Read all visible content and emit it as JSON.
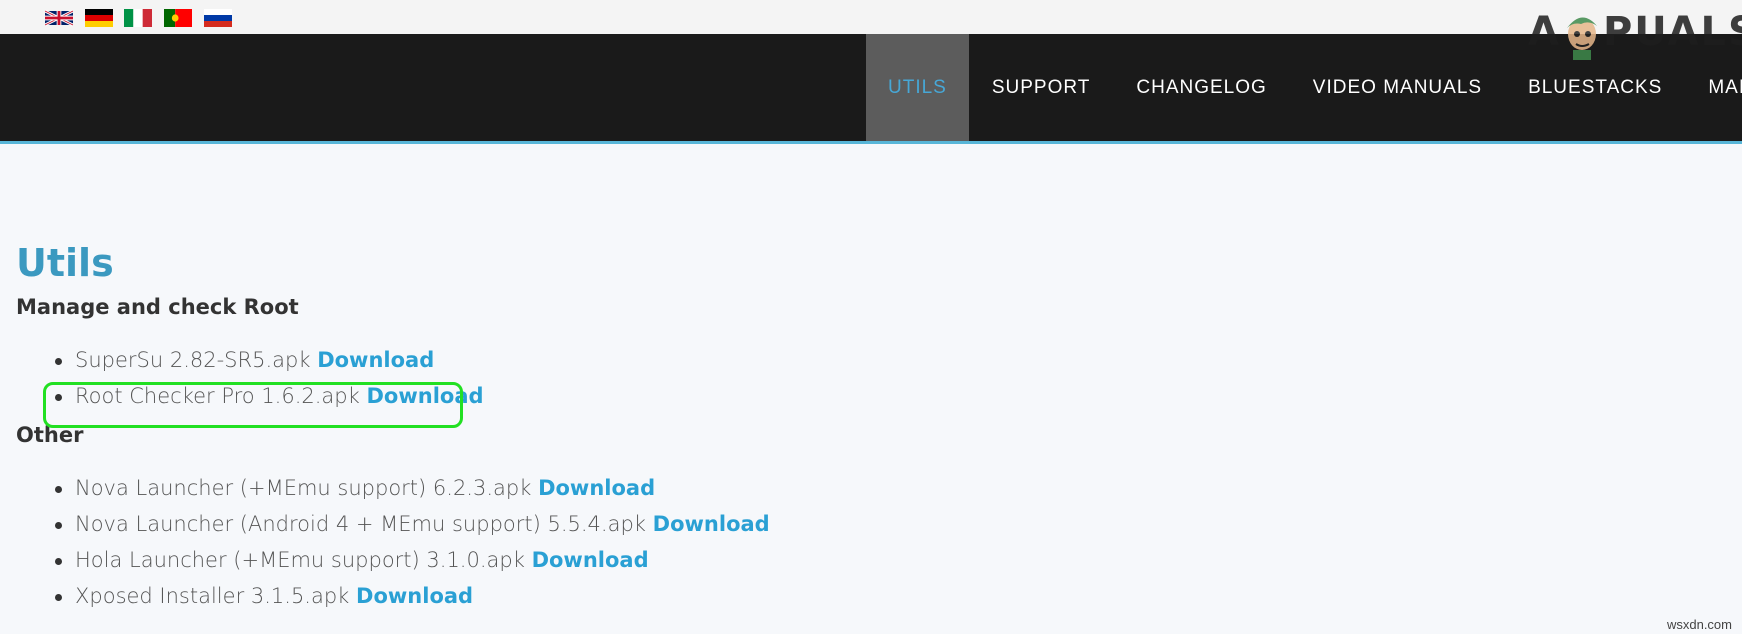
{
  "language_flags": [
    {
      "name": "english"
    },
    {
      "name": "german"
    },
    {
      "name": "italian"
    },
    {
      "name": "portuguese"
    },
    {
      "name": "russian"
    }
  ],
  "watermark": {
    "text_left": "A",
    "text_right": "PUALS"
  },
  "nav": {
    "items": [
      {
        "label": "UTILS",
        "active": true
      },
      {
        "label": "SUPPORT",
        "active": false
      },
      {
        "label": "CHANGELOG",
        "active": false
      },
      {
        "label": "VIDEO MANUALS",
        "active": false
      },
      {
        "label": "BLUESTACKS",
        "active": false
      },
      {
        "label": "MAIN",
        "active": false
      }
    ]
  },
  "page": {
    "title": "Utils",
    "sections": [
      {
        "heading": "Manage and check Root",
        "files": [
          {
            "name": "SuperSu 2.82-SR5.apk",
            "link": "Download"
          },
          {
            "name": "Root Checker Pro 1.6.2.apk",
            "link": "Download",
            "highlighted": true
          }
        ]
      },
      {
        "heading": "Other",
        "files": [
          {
            "name": "Nova Launcher (+MEmu support) 6.2.3.apk",
            "link": "Download"
          },
          {
            "name": "Nova Launcher (Android 4 + MEmu support) 5.5.4.apk",
            "link": "Download"
          },
          {
            "name": "Hola Launcher (+MEmu support) 3.1.0.apk",
            "link": "Download"
          },
          {
            "name": "Xposed Installer 3.1.5.apk",
            "link": "Download"
          }
        ]
      }
    ]
  },
  "colors": {
    "accent": "#47a7d6",
    "title": "#3b99c0",
    "link": "#2aa0d4",
    "navbar": "#1a1a1a",
    "highlight": "#22e022"
  },
  "footer": {
    "credit": "wsxdn.com"
  }
}
